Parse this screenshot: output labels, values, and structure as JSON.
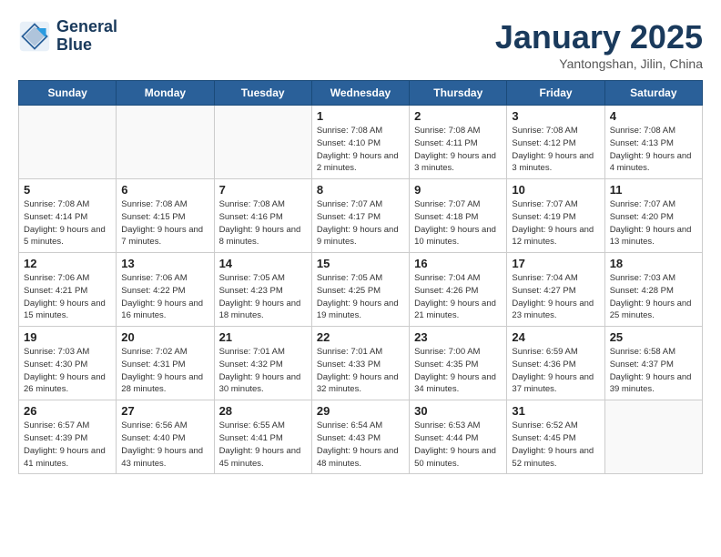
{
  "header": {
    "logo_line1": "General",
    "logo_line2": "Blue",
    "month": "January 2025",
    "location": "Yantongshan, Jilin, China"
  },
  "days_of_week": [
    "Sunday",
    "Monday",
    "Tuesday",
    "Wednesday",
    "Thursday",
    "Friday",
    "Saturday"
  ],
  "weeks": [
    [
      {
        "day": "",
        "info": ""
      },
      {
        "day": "",
        "info": ""
      },
      {
        "day": "",
        "info": ""
      },
      {
        "day": "1",
        "info": "Sunrise: 7:08 AM\nSunset: 4:10 PM\nDaylight: 9 hours and 2 minutes."
      },
      {
        "day": "2",
        "info": "Sunrise: 7:08 AM\nSunset: 4:11 PM\nDaylight: 9 hours and 3 minutes."
      },
      {
        "day": "3",
        "info": "Sunrise: 7:08 AM\nSunset: 4:12 PM\nDaylight: 9 hours and 3 minutes."
      },
      {
        "day": "4",
        "info": "Sunrise: 7:08 AM\nSunset: 4:13 PM\nDaylight: 9 hours and 4 minutes."
      }
    ],
    [
      {
        "day": "5",
        "info": "Sunrise: 7:08 AM\nSunset: 4:14 PM\nDaylight: 9 hours and 5 minutes."
      },
      {
        "day": "6",
        "info": "Sunrise: 7:08 AM\nSunset: 4:15 PM\nDaylight: 9 hours and 7 minutes."
      },
      {
        "day": "7",
        "info": "Sunrise: 7:08 AM\nSunset: 4:16 PM\nDaylight: 9 hours and 8 minutes."
      },
      {
        "day": "8",
        "info": "Sunrise: 7:07 AM\nSunset: 4:17 PM\nDaylight: 9 hours and 9 minutes."
      },
      {
        "day": "9",
        "info": "Sunrise: 7:07 AM\nSunset: 4:18 PM\nDaylight: 9 hours and 10 minutes."
      },
      {
        "day": "10",
        "info": "Sunrise: 7:07 AM\nSunset: 4:19 PM\nDaylight: 9 hours and 12 minutes."
      },
      {
        "day": "11",
        "info": "Sunrise: 7:07 AM\nSunset: 4:20 PM\nDaylight: 9 hours and 13 minutes."
      }
    ],
    [
      {
        "day": "12",
        "info": "Sunrise: 7:06 AM\nSunset: 4:21 PM\nDaylight: 9 hours and 15 minutes."
      },
      {
        "day": "13",
        "info": "Sunrise: 7:06 AM\nSunset: 4:22 PM\nDaylight: 9 hours and 16 minutes."
      },
      {
        "day": "14",
        "info": "Sunrise: 7:05 AM\nSunset: 4:23 PM\nDaylight: 9 hours and 18 minutes."
      },
      {
        "day": "15",
        "info": "Sunrise: 7:05 AM\nSunset: 4:25 PM\nDaylight: 9 hours and 19 minutes."
      },
      {
        "day": "16",
        "info": "Sunrise: 7:04 AM\nSunset: 4:26 PM\nDaylight: 9 hours and 21 minutes."
      },
      {
        "day": "17",
        "info": "Sunrise: 7:04 AM\nSunset: 4:27 PM\nDaylight: 9 hours and 23 minutes."
      },
      {
        "day": "18",
        "info": "Sunrise: 7:03 AM\nSunset: 4:28 PM\nDaylight: 9 hours and 25 minutes."
      }
    ],
    [
      {
        "day": "19",
        "info": "Sunrise: 7:03 AM\nSunset: 4:30 PM\nDaylight: 9 hours and 26 minutes."
      },
      {
        "day": "20",
        "info": "Sunrise: 7:02 AM\nSunset: 4:31 PM\nDaylight: 9 hours and 28 minutes."
      },
      {
        "day": "21",
        "info": "Sunrise: 7:01 AM\nSunset: 4:32 PM\nDaylight: 9 hours and 30 minutes."
      },
      {
        "day": "22",
        "info": "Sunrise: 7:01 AM\nSunset: 4:33 PM\nDaylight: 9 hours and 32 minutes."
      },
      {
        "day": "23",
        "info": "Sunrise: 7:00 AM\nSunset: 4:35 PM\nDaylight: 9 hours and 34 minutes."
      },
      {
        "day": "24",
        "info": "Sunrise: 6:59 AM\nSunset: 4:36 PM\nDaylight: 9 hours and 37 minutes."
      },
      {
        "day": "25",
        "info": "Sunrise: 6:58 AM\nSunset: 4:37 PM\nDaylight: 9 hours and 39 minutes."
      }
    ],
    [
      {
        "day": "26",
        "info": "Sunrise: 6:57 AM\nSunset: 4:39 PM\nDaylight: 9 hours and 41 minutes."
      },
      {
        "day": "27",
        "info": "Sunrise: 6:56 AM\nSunset: 4:40 PM\nDaylight: 9 hours and 43 minutes."
      },
      {
        "day": "28",
        "info": "Sunrise: 6:55 AM\nSunset: 4:41 PM\nDaylight: 9 hours and 45 minutes."
      },
      {
        "day": "29",
        "info": "Sunrise: 6:54 AM\nSunset: 4:43 PM\nDaylight: 9 hours and 48 minutes."
      },
      {
        "day": "30",
        "info": "Sunrise: 6:53 AM\nSunset: 4:44 PM\nDaylight: 9 hours and 50 minutes."
      },
      {
        "day": "31",
        "info": "Sunrise: 6:52 AM\nSunset: 4:45 PM\nDaylight: 9 hours and 52 minutes."
      },
      {
        "day": "",
        "info": ""
      }
    ]
  ]
}
